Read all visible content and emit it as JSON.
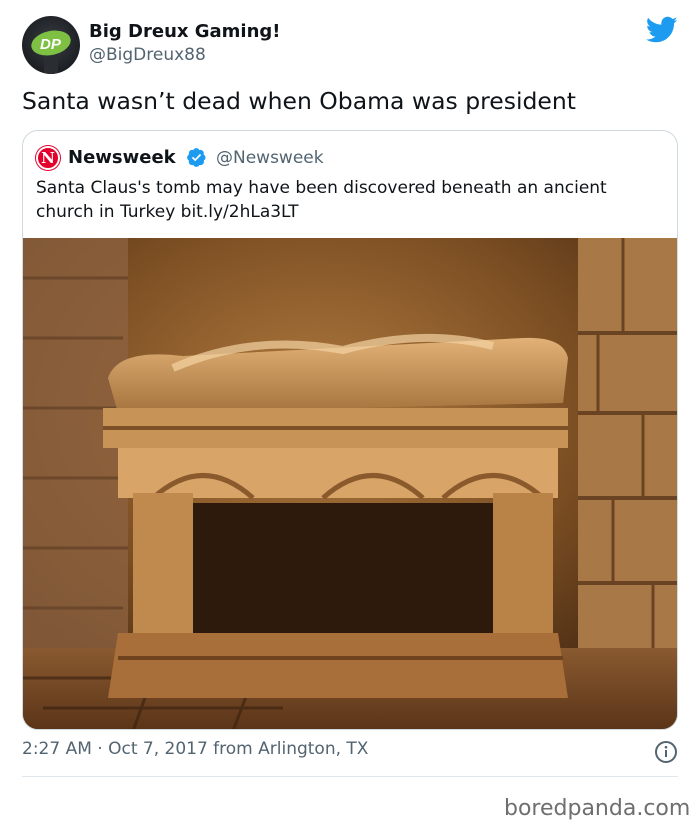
{
  "author": {
    "display_name": "Big Dreux Gaming!",
    "handle": "@BigDreux88",
    "avatar_icon": "dp-logo-avatar-icon"
  },
  "brand_icon": "twitter-bird-icon",
  "brand_color": "#1d9bf0",
  "tweet_text": "Santa wasn’t dead when Obama was president",
  "quoted_tweet": {
    "logo_letter": "N",
    "logo_color": "#e4002b",
    "display_name": "Newsweek",
    "verified_icon": "verified-badge-icon",
    "handle": "@Newsweek",
    "text": "Santa Claus's tomb may have been discovered beneath an ancient church in Turkey bit.ly/2hLa3LT",
    "image": "stone-sarcophagus-photo"
  },
  "timestamp": "2:27 AM · Oct 7, 2017 from Arlington, TX",
  "info_icon": "info-icon",
  "watermark": "boredpanda.com"
}
